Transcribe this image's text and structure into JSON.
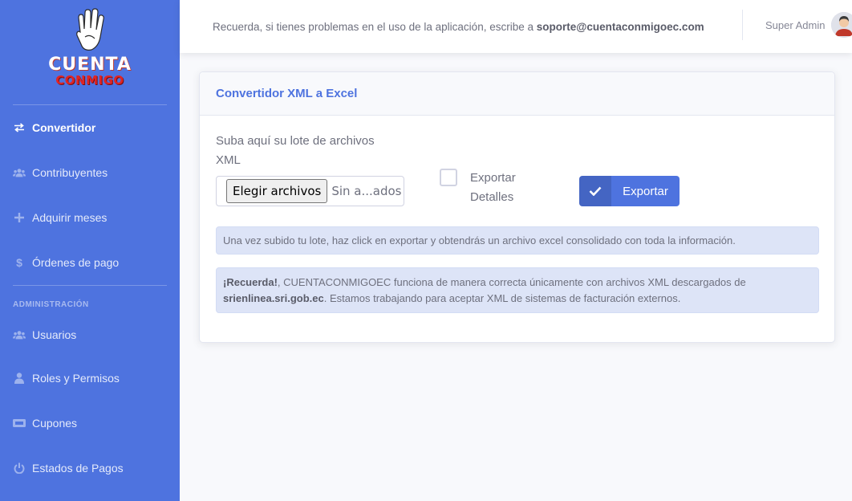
{
  "brand": {
    "line1": "CUENTA",
    "line2": "CONMIGO",
    "colors": {
      "sidebar": "#4e73df",
      "brand_red": "#e02424"
    }
  },
  "sidebar": {
    "items": [
      {
        "label": "Convertidor",
        "icon": "exchange-icon",
        "active": true
      },
      {
        "label": "Contribuyentes",
        "icon": "users-icon",
        "active": false
      },
      {
        "label": "Adquirir meses",
        "icon": "plus-icon",
        "active": false
      },
      {
        "label": "Órdenes de pago",
        "icon": "dollar-icon",
        "active": false
      }
    ],
    "section_heading": "ADMINISTRACIÓN",
    "admin_items": [
      {
        "label": "Usuarios",
        "icon": "users-icon"
      },
      {
        "label": "Roles y Permisos",
        "icon": "user-icon"
      },
      {
        "label": "Cupones",
        "icon": "ticket-icon"
      },
      {
        "label": "Estados de Pagos",
        "icon": "power-icon"
      }
    ]
  },
  "topbar": {
    "notice_prefix": "Recuerda, si tienes problemas en el uso de la aplicación, escribe a ",
    "notice_email": "soporte@cuentaconmigoec.com",
    "user_name": "Super Admin",
    "avatar_icon": "avatar-icon"
  },
  "card": {
    "title": "Convertidor XML a Excel",
    "upload_label": "Suba aquí su lote de archivos XML",
    "file_button": "Elegir archivos",
    "file_status": "Sin a...ados",
    "checkbox_label": "Exportar Detalles",
    "checkbox_checked": false,
    "export_button": "Exportar",
    "export_icon": "check-icon",
    "info_text": "Una vez subido tu lote, haz click en exportar y obtendrás un archivo excel consolidado con toda la información.",
    "reminder_bold": "¡Recuerda!",
    "reminder_text1": ", CUENTACONMIGOEC funciona de manera correcta únicamente con archivos XML descargados de ",
    "reminder_domain": "srienlinea.sri.gob.ec",
    "reminder_text2": ". Estamos trabajando para aceptar XML de sistemas de facturación externos."
  }
}
